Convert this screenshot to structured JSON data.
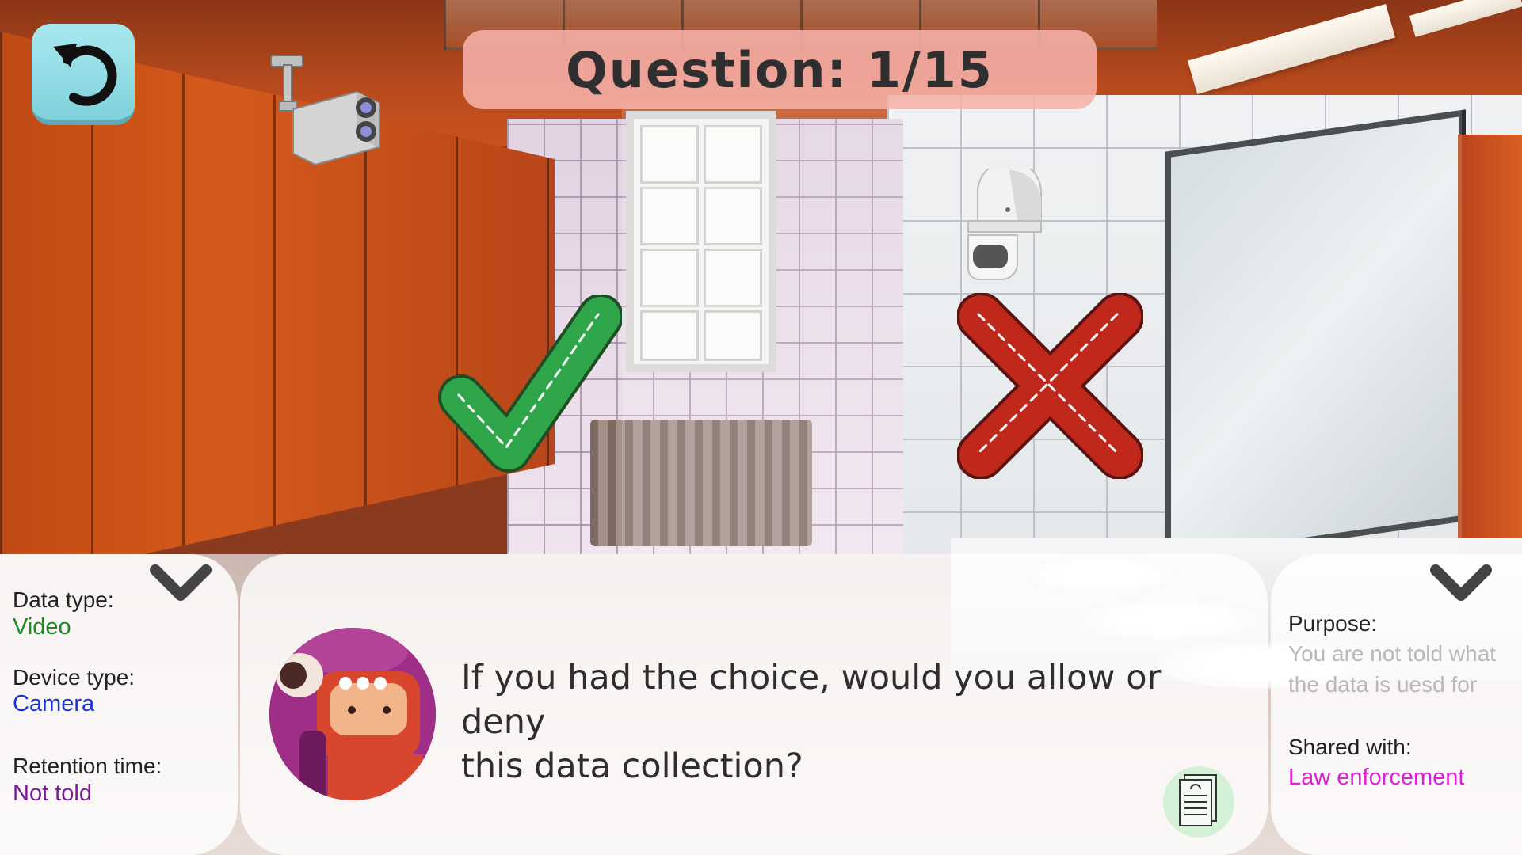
{
  "question": {
    "label": "Question: 1/15"
  },
  "icons": {
    "restart": "restart-icon",
    "camera": "security-camera-icon",
    "sensor": "motion-sensor-icon",
    "allow": "checkmark-icon",
    "deny": "cross-icon",
    "collapse": "chevron-down-icon",
    "document": "document-icon",
    "avatar": "robot-avatar"
  },
  "left_panel": {
    "data_type_label": "Data type:",
    "data_type_value": "Video",
    "device_type_label": "Device type:",
    "device_type_value": "Camera",
    "retention_label": "Retention time:",
    "retention_value": "Not told"
  },
  "center_panel": {
    "prompt_line1": "If you had the choice, would you allow or deny",
    "prompt_line2": "this data collection?"
  },
  "right_panel": {
    "purpose_label": "Purpose:",
    "purpose_value_line1": "You are not told what",
    "purpose_value_line2": "the data is uesd for",
    "shared_label": "Shared with:",
    "shared_value": "Law enforcement"
  },
  "colors": {
    "data_type_value": "#1f8a1f",
    "device_type_value": "#1a33d6",
    "retention_value": "#7a1a9a",
    "purpose_value": "#b8b8b8",
    "shared_value": "#e01fd8",
    "allow": "#2fa64a",
    "deny": "#c0281c",
    "banner": "#f6b0aa"
  }
}
